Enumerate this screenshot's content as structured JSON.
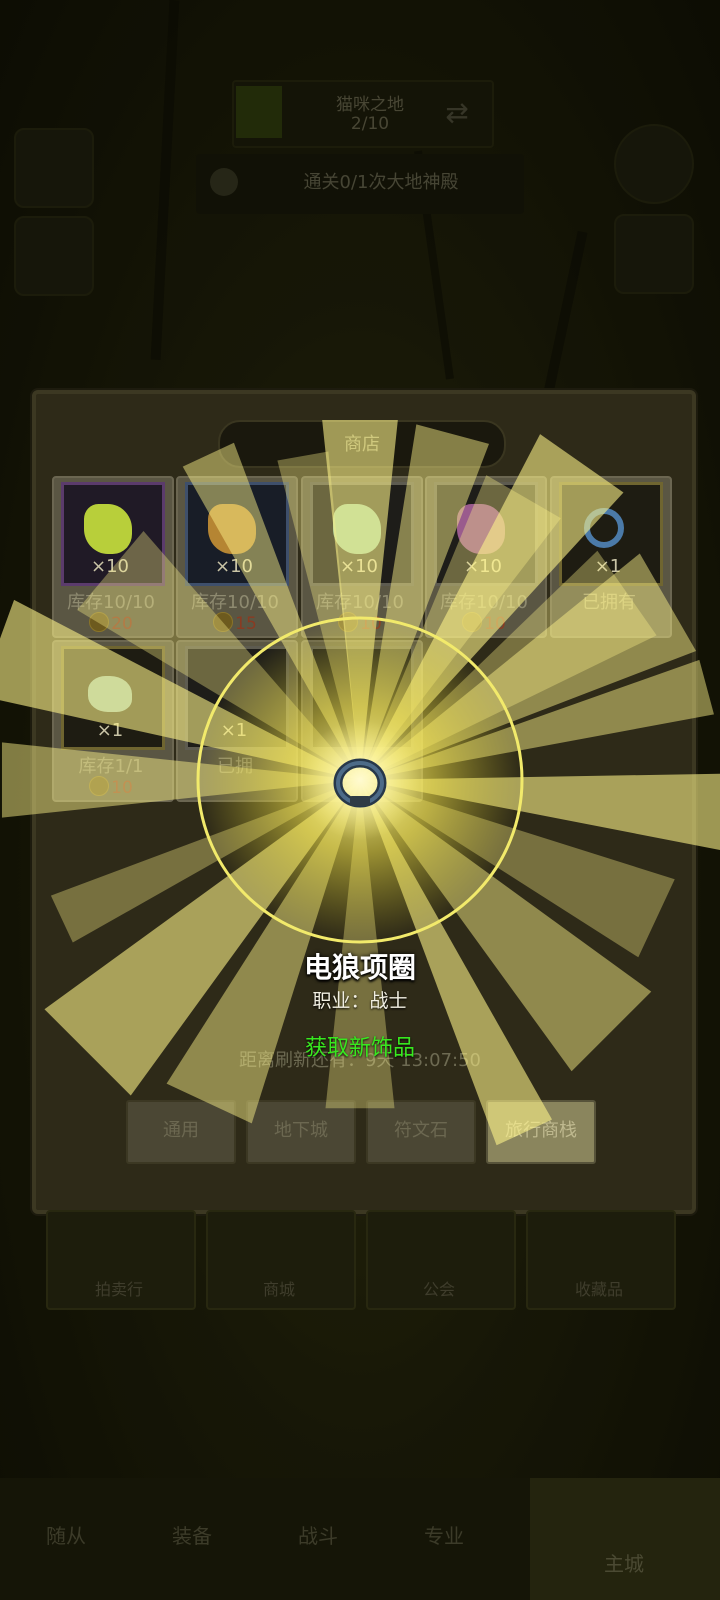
{
  "top": {
    "stage_name": "猫咪之地",
    "stage_progress": "2/10",
    "quest_text": "通关0/1次大地神殿"
  },
  "shop": {
    "title": "商店",
    "items": [
      {
        "qty": "×10",
        "stock": "库存10/10",
        "price": "20",
        "frame": "purple"
      },
      {
        "qty": "×10",
        "stock": "库存10/10",
        "price": "15",
        "frame": "blue"
      },
      {
        "qty": "×10",
        "stock": "库存10/10",
        "price": "10",
        "frame": "gray"
      },
      {
        "qty": "×10",
        "stock": "库存10/10",
        "price": "10",
        "frame": "gray"
      },
      {
        "qty": "×1",
        "stock": "已拥有",
        "price": "",
        "frame": "gold"
      },
      {
        "qty": "×1",
        "stock": "库存1/1",
        "price": "10",
        "frame": "gold"
      },
      {
        "qty": "×1",
        "stock": "已拥",
        "price": "",
        "frame": "gray"
      }
    ],
    "refresh_text": "距离刷新还有：9天 13:07:50",
    "tabs": [
      "通用",
      "地下城",
      "符文石",
      "旅行商栈"
    ],
    "active_tab": "旅行商栈"
  },
  "reward": {
    "name": "电狼项圈",
    "job": "职业：战士",
    "notice": "获取新饰品"
  },
  "under_modal": {
    "cards": [
      "拍卖行",
      "商城",
      "公会",
      "收藏品"
    ]
  },
  "nav": {
    "items": [
      "随从",
      "装备",
      "战斗",
      "专业",
      "主城"
    ]
  },
  "colors": {
    "glow": "#fff46a",
    "notice_green": "#38e81f"
  }
}
